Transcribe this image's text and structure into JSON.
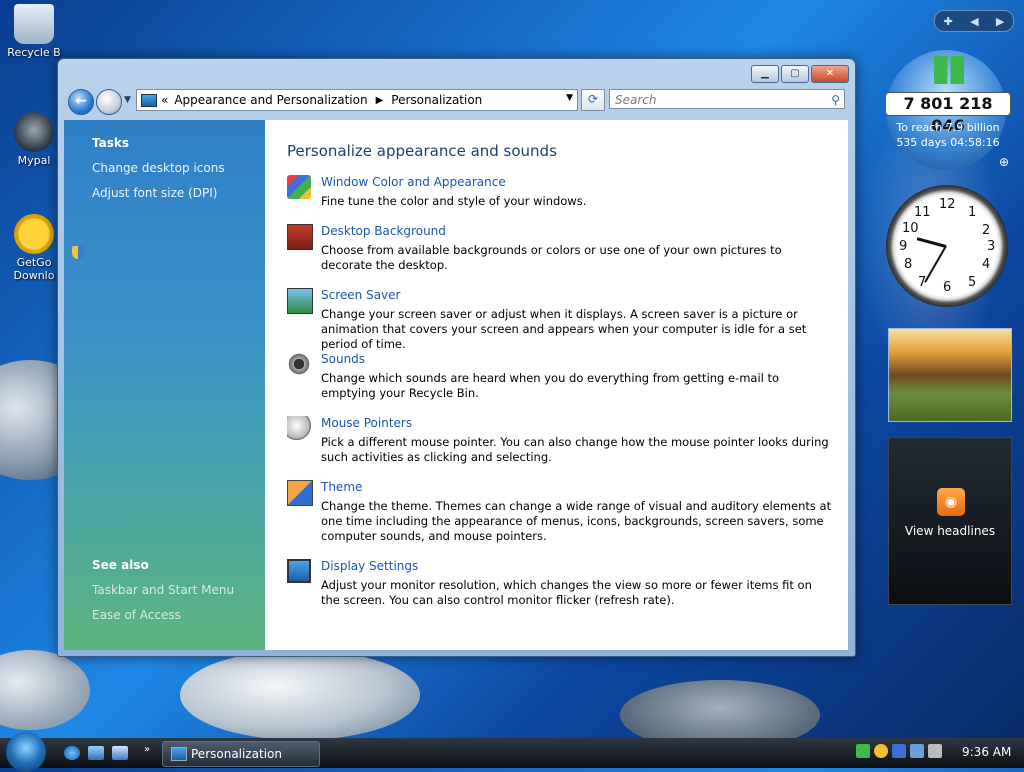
{
  "desktop": {
    "icons": [
      {
        "label": "Recycle B"
      },
      {
        "label": "Mypal"
      },
      {
        "label": "GetGo Downlo"
      }
    ]
  },
  "window": {
    "breadcrumb_prefix": "«",
    "breadcrumb": [
      "Appearance and Personalization",
      "Personalization"
    ],
    "search_placeholder": "Search",
    "tasks": {
      "heading": "Tasks",
      "items": [
        "Change desktop icons",
        "Adjust font size (DPI)"
      ]
    },
    "see_also": {
      "heading": "See also",
      "items": [
        "Taskbar and Start Menu",
        "Ease of Access"
      ]
    },
    "main": {
      "title": "Personalize appearance and sounds",
      "items": [
        {
          "title": "Window Color and Appearance",
          "icon": "color-palette-icon",
          "desc": "Fine tune the color and style of your windows."
        },
        {
          "title": "Desktop Background",
          "icon": "desktop-background-icon",
          "desc": "Choose from available backgrounds or colors or use one of your own pictures to decorate the desktop."
        },
        {
          "title": "Screen Saver",
          "icon": "screen-saver-icon",
          "desc": "Change your screen saver or adjust when it displays. A screen saver is a picture or animation that covers your screen and appears when your computer is idle for a set period of time."
        },
        {
          "title": "Sounds",
          "icon": "sounds-icon",
          "desc": "Change which sounds are heard when you do everything from getting e-mail to emptying your Recycle Bin."
        },
        {
          "title": "Mouse Pointers",
          "icon": "mouse-icon",
          "desc": "Pick a different mouse pointer. You can also change how the mouse pointer looks during such activities as clicking and selecting."
        },
        {
          "title": "Theme",
          "icon": "theme-icon",
          "desc": "Change the theme. Themes can change a wide range of visual and auditory elements at one time including the appearance of menus, icons, backgrounds, screen savers, some computer sounds, and mouse pointers."
        },
        {
          "title": "Display Settings",
          "icon": "display-icon",
          "desc": "Adjust your monitor resolution, which changes the view so more or fewer items fit on the screen. You can also control monitor flicker (refresh rate)."
        }
      ]
    }
  },
  "gadgets": {
    "population": {
      "count": "7 801 218 046",
      "line1": "To reach 7.9 billion",
      "line2": "535 days 04:58:16"
    },
    "clock": {
      "numbers": [
        "12",
        "1",
        "2",
        "3",
        "4",
        "5",
        "6",
        "7",
        "8",
        "9",
        "10",
        "11"
      ]
    },
    "rss": {
      "label": "View headlines"
    }
  },
  "taskbar": {
    "task_label": "Personalization",
    "time": "9:36 AM"
  }
}
